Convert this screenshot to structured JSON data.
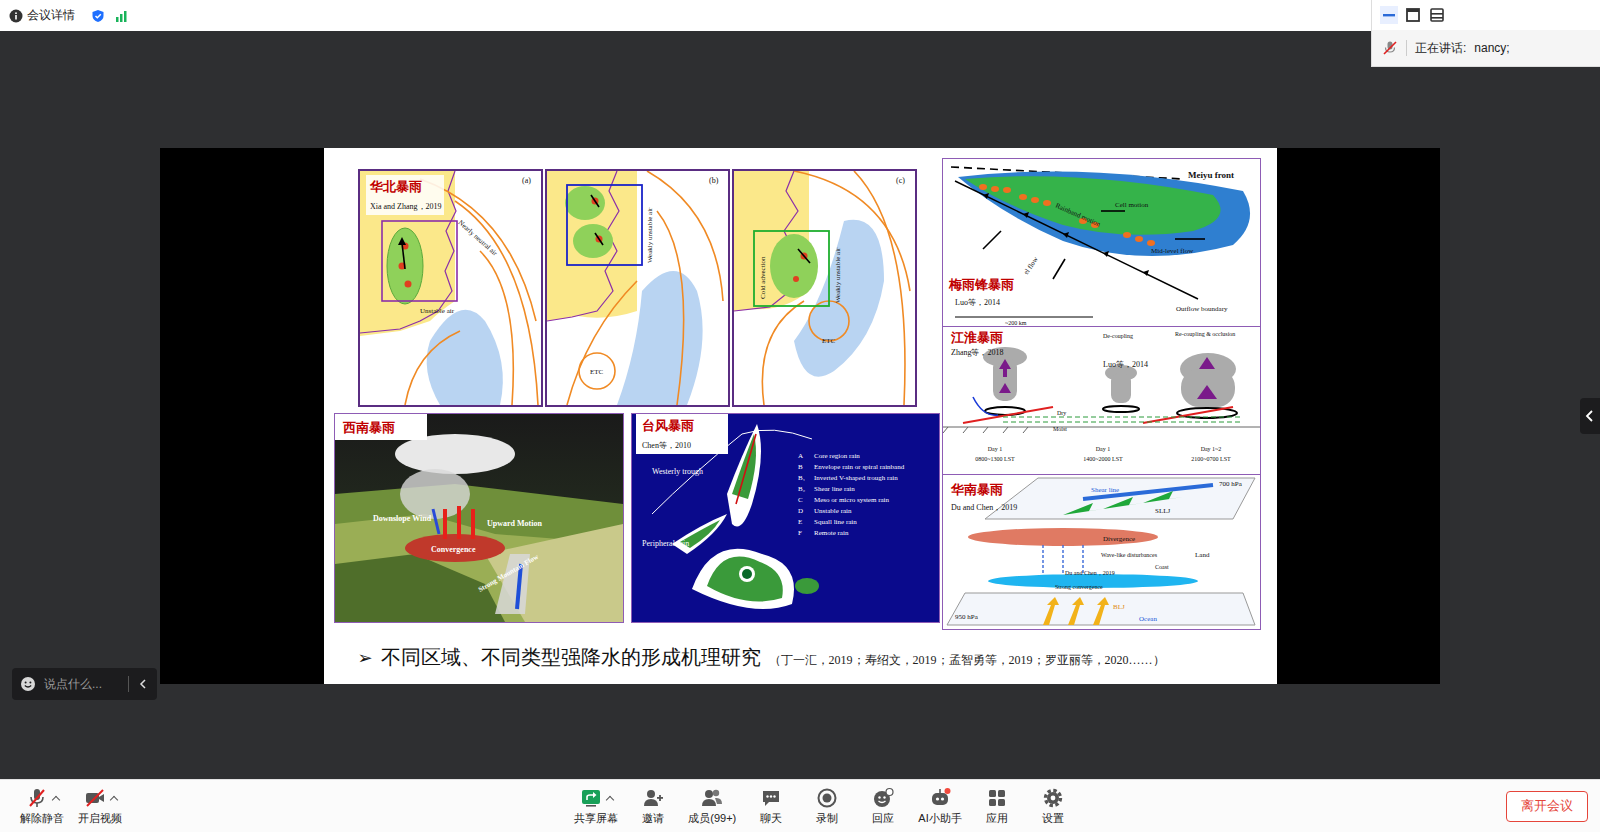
{
  "top_bar": {
    "title": "会议详情"
  },
  "speaker_panel": {
    "label": "正在讲话:",
    "speaker": "nancy;",
    "mic_muted": true
  },
  "slide": {
    "north_china": {
      "title": "华北暴雨",
      "citation": "Xia and Zhang，2019",
      "panels": [
        {
          "tag": "(a)",
          "labels": [
            "Nearly neutral air",
            "Unstable air"
          ]
        },
        {
          "tag": "(b)",
          "labels": [
            "Weakly unstable air",
            "ETC"
          ]
        },
        {
          "tag": "(c)",
          "labels": [
            "Cold advection",
            "Weakly unstable air",
            "ETC"
          ]
        }
      ]
    },
    "meiyu": {
      "title": "梅雨锋暴雨",
      "citation": "Luo等，2014",
      "labels": [
        "Meiyu front",
        "Cell motion",
        "Rainband motion",
        "Mid-level flow",
        "Outflow boundary",
        "el flow",
        "~200 km"
      ]
    },
    "jianghuai": {
      "title": "江淮暴雨",
      "citations": [
        "Zhang等，2018",
        "Luo等，2014"
      ],
      "stages": [
        "De-coupling",
        "Re-coupling & occlusion"
      ],
      "layers": [
        "Dry",
        "Moist"
      ],
      "times": [
        {
          "day": "Day 1",
          "time": "0800~1300 LST"
        },
        {
          "day": "Day 1",
          "time": "1400~2000 LST"
        },
        {
          "day": "Day 1~2",
          "time": "2100~0700 LST"
        }
      ]
    },
    "south_china": {
      "title": "华南暴雨",
      "citation": "Du and Chen，2019",
      "inner_citation": "Du and Chen，2019",
      "labels": [
        "700 hPa",
        "Shear line",
        "SLLJ",
        "Divergence",
        "Wave-like disturbances",
        "Coast",
        "Land",
        "Strong convergence",
        "950 hPa",
        "BLJ",
        "Ocean"
      ]
    },
    "southwest": {
      "title": "西南暴雨",
      "labels": [
        "Downslope Wind",
        "Upward Motion",
        "Convergence",
        "Strong Mountain Flow"
      ]
    },
    "typhoon": {
      "title": "台风暴雨",
      "citation": "Chen等，2010",
      "labels": [
        "Westerly trough",
        "Peripheral rain"
      ],
      "legend": [
        {
          "key": "A",
          "text": "Core region rain"
        },
        {
          "key": "B",
          "text": "Envelope rain or spiral rainband"
        },
        {
          "key": "B₁",
          "text": "Inverted V-shaped trough rain"
        },
        {
          "key": "B₂",
          "text": "Shear line rain"
        },
        {
          "key": "C",
          "text": "Meso or micro system rain"
        },
        {
          "key": "D",
          "text": "Unstable rain"
        },
        {
          "key": "E",
          "text": "Squall line rain"
        },
        {
          "key": "F",
          "text": "Remote rain"
        }
      ]
    },
    "bullet": {
      "marker": "➢",
      "text": "不同区域、不同类型强降水的形成机理研究",
      "refs": "（丁一汇，2019；寿绍文，2019；孟智勇等，2019；罗亚丽等，2020……）"
    }
  },
  "chat_input": {
    "placeholder": "说点什么..."
  },
  "toolbar": {
    "left": [
      {
        "label": "解除静音",
        "kind": "mic",
        "off": true,
        "menu": true
      },
      {
        "label": "开启视频",
        "kind": "video",
        "off": true,
        "menu": true
      }
    ],
    "center": [
      {
        "label": "共享屏幕",
        "kind": "share",
        "menu": true,
        "badge": false
      },
      {
        "label": "邀请",
        "kind": "invite",
        "menu": false,
        "badge": false
      },
      {
        "label": "成员(99+)",
        "kind": "members",
        "menu": false,
        "badge": false
      },
      {
        "label": "聊天",
        "kind": "chat",
        "menu": false,
        "badge": false
      },
      {
        "label": "录制",
        "kind": "record",
        "menu": false,
        "badge": false
      },
      {
        "label": "回应",
        "kind": "react",
        "menu": false,
        "badge": false
      },
      {
        "label": "AI小助手",
        "kind": "ai",
        "menu": false,
        "badge": true
      },
      {
        "label": "应用",
        "kind": "apps",
        "menu": false,
        "badge": false
      },
      {
        "label": "设置",
        "kind": "settings",
        "menu": false,
        "badge": false
      }
    ],
    "leave": "离开会议"
  }
}
